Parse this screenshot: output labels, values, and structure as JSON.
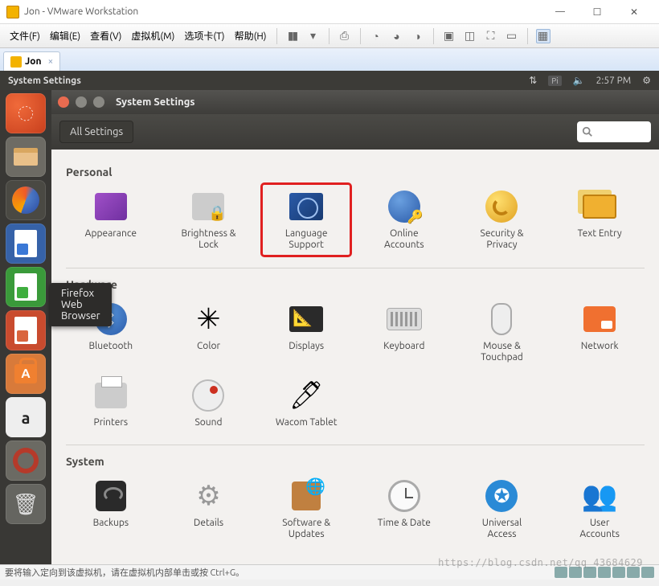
{
  "vmware": {
    "title": "Jon - VMware Workstation",
    "menus": [
      "文件(F)",
      "编辑(E)",
      "查看(V)",
      "虚拟机(M)",
      "选项卡(T)",
      "帮助(H)"
    ],
    "tab_label": "Jon",
    "status": "要将输入定向到该虚拟机，请在虚拟机内部单击或按 Ctrl+G。"
  },
  "ubuntu_top": {
    "title": "System Settings",
    "pi": "Pi",
    "time": "2:57 PM"
  },
  "tooltip": "Firefox Web Browser",
  "settings_window": {
    "title": "System Settings",
    "all_settings": "All Settings",
    "search_placeholder": ""
  },
  "sections": {
    "personal": {
      "title": "Personal",
      "items": [
        {
          "label": "Appearance"
        },
        {
          "label": "Brightness &\nLock"
        },
        {
          "label": "Language\nSupport",
          "highlight": true
        },
        {
          "label": "Online\nAccounts"
        },
        {
          "label": "Security &\nPrivacy"
        },
        {
          "label": "Text Entry"
        }
      ]
    },
    "hardware": {
      "title": "Hardware",
      "row1": [
        {
          "label": "Bluetooth"
        },
        {
          "label": "Color"
        },
        {
          "label": "Displays"
        },
        {
          "label": "Keyboard"
        },
        {
          "label": "Mouse &\nTouchpad"
        },
        {
          "label": "Network"
        }
      ],
      "row2": [
        {
          "label": "Printers"
        },
        {
          "label": "Sound"
        },
        {
          "label": "Wacom Tablet"
        }
      ]
    },
    "system": {
      "title": "System",
      "items": [
        {
          "label": "Backups"
        },
        {
          "label": "Details"
        },
        {
          "label": "Software &\nUpdates"
        },
        {
          "label": "Time & Date"
        },
        {
          "label": "Universal\nAccess"
        },
        {
          "label": "User\nAccounts"
        }
      ]
    }
  },
  "watermark": "https://blog.csdn.net/qq_43684629"
}
